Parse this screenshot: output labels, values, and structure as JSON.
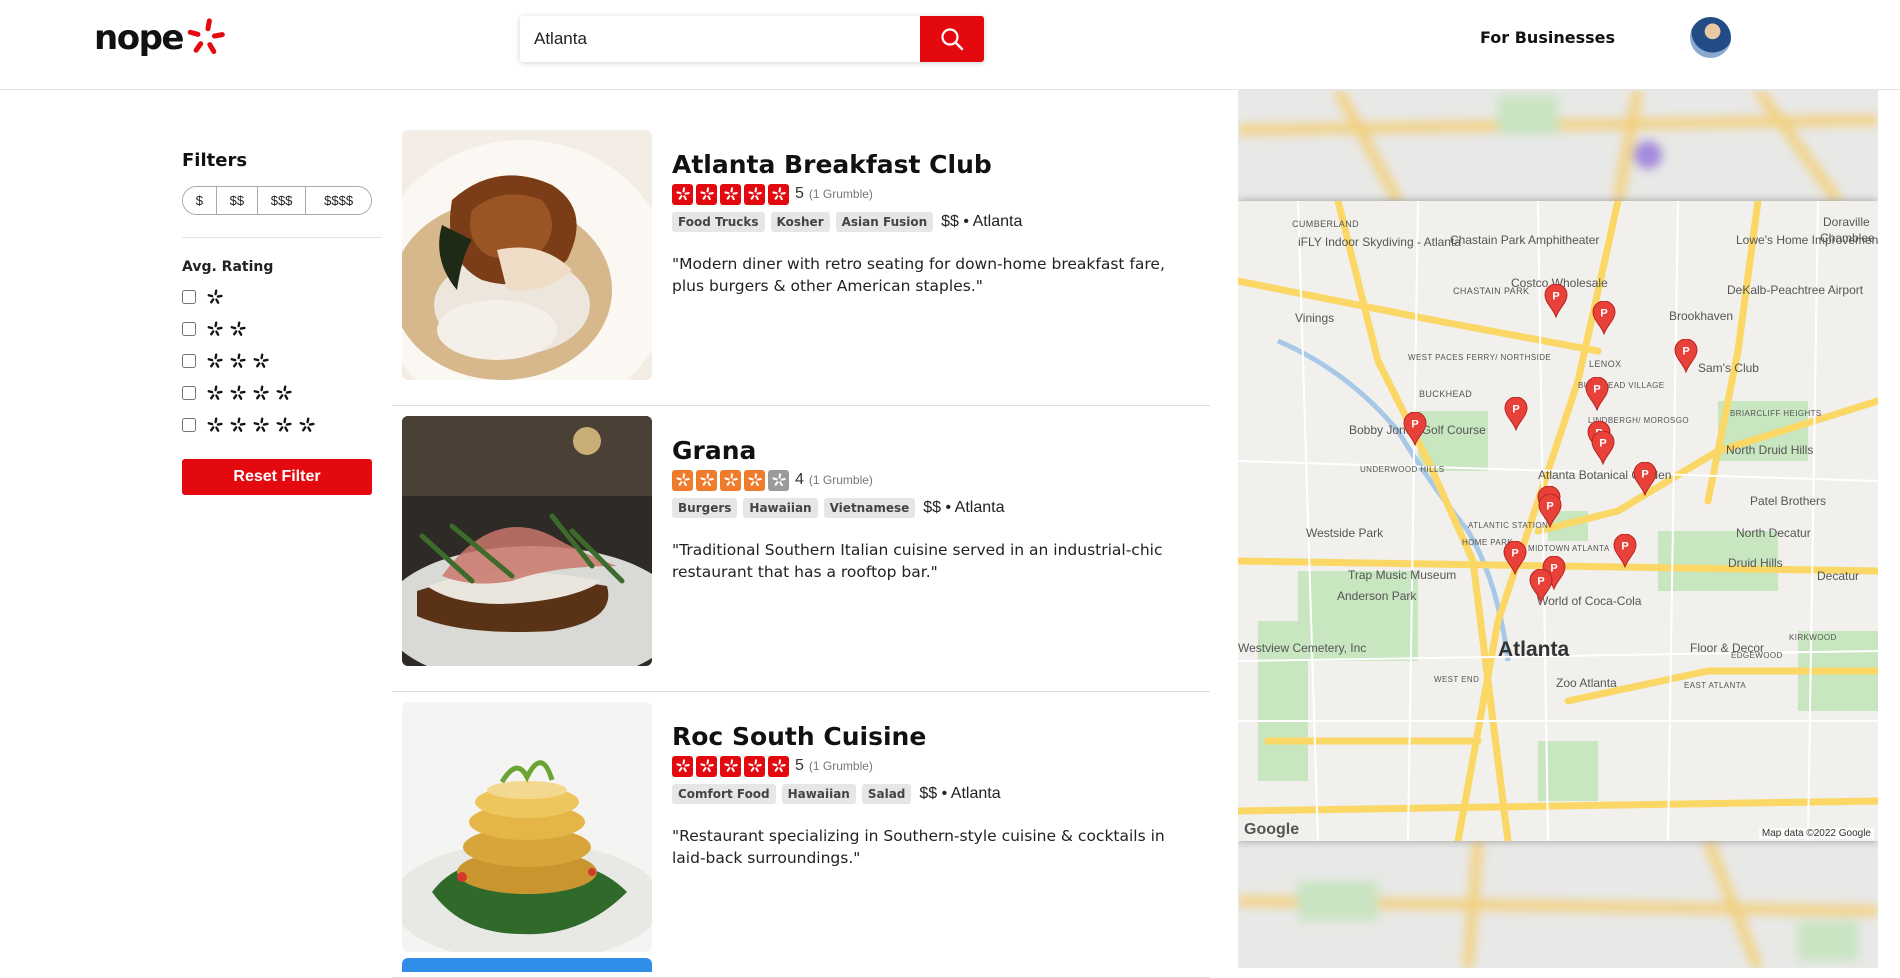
{
  "header": {
    "logo_text": "nope",
    "search_value": "Atlanta",
    "for_businesses": "For Businesses"
  },
  "filters": {
    "title": "Filters",
    "price_options": [
      "$",
      "$$",
      "$$$",
      "$$$$"
    ],
    "avg_rating_title": "Avg. Rating",
    "rating_options": [
      1,
      2,
      3,
      4,
      5
    ],
    "reset_label": "Reset Filter"
  },
  "listings": [
    {
      "name": "Atlanta Breakfast Club",
      "rating": 5,
      "grumbles": "(1 Grumble)",
      "tags": [
        "Food Trucks",
        "Kosher",
        "Asian Fusion"
      ],
      "price_location": "$$ • Atlanta",
      "description": "\"Modern diner with retro seating for down-home breakfast fare, plus burgers & other American staples.\""
    },
    {
      "name": "Grana",
      "rating": 4,
      "grumbles": "(1 Grumble)",
      "tags": [
        "Burgers",
        "Hawaiian",
        "Vietnamese"
      ],
      "price_location": "$$ • Atlanta",
      "description": "\"Traditional Southern Italian cuisine served in an industrial-chic restaurant that has a rooftop bar.\""
    },
    {
      "name": "Roc South Cuisine",
      "rating": 5,
      "grumbles": "(1 Grumble)",
      "tags": [
        "Comfort Food",
        "Hawaiian",
        "Salad"
      ],
      "price_location": "$$ • Atlanta",
      "description": "\"Restaurant specializing in Southern-style cuisine & cocktails in laid-back surroundings.\""
    }
  ],
  "map": {
    "labels": [
      "Doraville",
      "Chamblee",
      "Lowe's Home Improvement",
      "DeKalb-Peachtree Airport",
      "Chastain Park Amphitheater",
      "iFLY Indoor Skydiving - Atlanta",
      "CUMBERLAND",
      "CHASTAIN PARK",
      "Costco Wholesale",
      "Vinings",
      "Brookhaven",
      "WEST PACES FERRY/ NORTHSIDE",
      "BUCKHEAD",
      "BUCKHEAD VILLAGE",
      "LENOX",
      "Sam's Club",
      "BRIARCLIFF HEIGHTS",
      "North Druid Hills",
      "Bobby Jones Golf Course",
      "LINDBERGH/ MOROSGO",
      "UNDERWOOD HILLS",
      "Atlanta Botanical Garden",
      "Patel Brothers",
      "Westside Park",
      "ATLANTIC STATION",
      "HOME PARK",
      "MIDTOWN ATLANTA",
      "North Decatur",
      "Druid Hills",
      "Decatur",
      "Trap Music Museum",
      "Anderson Park",
      "World of Coca-Cola",
      "Westview Cemetery, Inc",
      "Atlanta",
      "Floor & Decor",
      "EDGEWOOD",
      "KIRKWOOD",
      "WEST END",
      "Zoo Atlanta",
      "EAST ATLANTA"
    ],
    "copyright": "Map data ©2022 Google",
    "google": "Google",
    "pin_letter": "P"
  }
}
